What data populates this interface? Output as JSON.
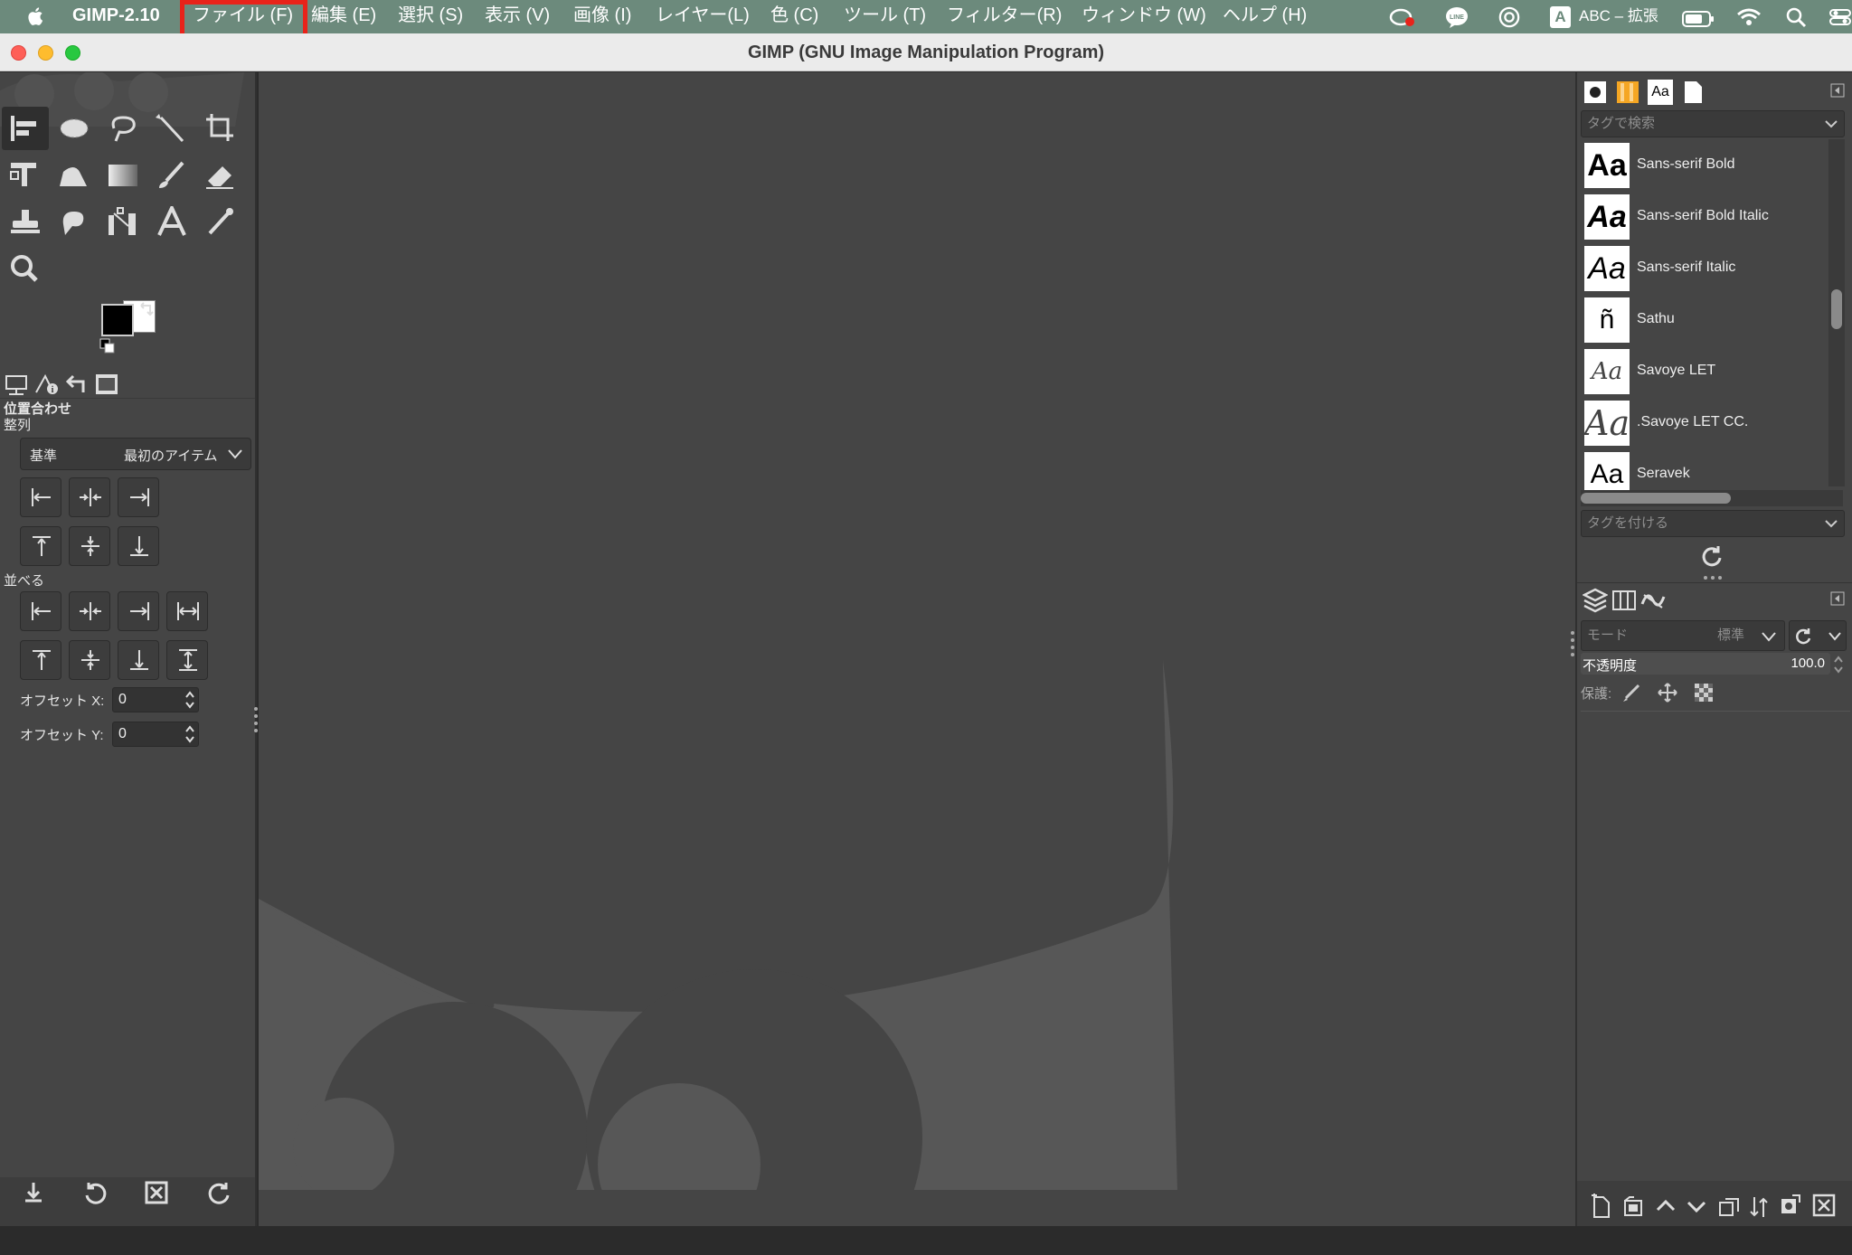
{
  "menubar": {
    "app_name": "GIMP-2.10",
    "items": [
      "ファイル (F)",
      "編集 (E)",
      "選択 (S)",
      "表示 (V)",
      "画像 (I)",
      "レイヤー(L)",
      "色 (C)",
      "ツール (T)",
      "フィルター(R)",
      "ウィンドウ (W)",
      "ヘルプ (H)"
    ],
    "input_method": "ABC – 拡張",
    "input_method_letter": "A",
    "line_icon_text": "LINE"
  },
  "window": {
    "title": "GIMP (GNU Image Manipulation Program)"
  },
  "tool_options": {
    "title": "位置合わせ",
    "align_section": "整列",
    "relative_label": "基準",
    "relative_value": "最初のアイテム",
    "distribute_section": "並べる",
    "offset_x_label": "オフセット X:",
    "offset_x_value": "0",
    "offset_y_label": "オフセット Y:",
    "offset_y_value": "0"
  },
  "fonts_panel": {
    "tab_label": "Aa",
    "tag_search_placeholder": "タグで検索",
    "tag_assign_placeholder": "タグを付ける",
    "fonts": [
      {
        "name": "Sans-serif Bold",
        "sample": "Aa"
      },
      {
        "name": "Sans-serif Bold Italic",
        "sample": "Aa"
      },
      {
        "name": "Sans-serif Italic",
        "sample": "Aa"
      },
      {
        "name": "Sathu",
        "sample": "ñ"
      },
      {
        "name": "Savoye LET",
        "sample": "Aa"
      },
      {
        "name": ".Savoye LET CC.",
        "sample": "Aa"
      },
      {
        "name": "Seravek",
        "sample": "Aa"
      }
    ]
  },
  "layers_panel": {
    "mode_label": "モード",
    "mode_value": "標準",
    "opacity_label": "不透明度",
    "opacity_value": "100.0",
    "lock_label": "保護:"
  },
  "colors": {
    "menubar": "#6c8a7c",
    "panel_bg": "#454545",
    "highlight": "#e8231a"
  }
}
